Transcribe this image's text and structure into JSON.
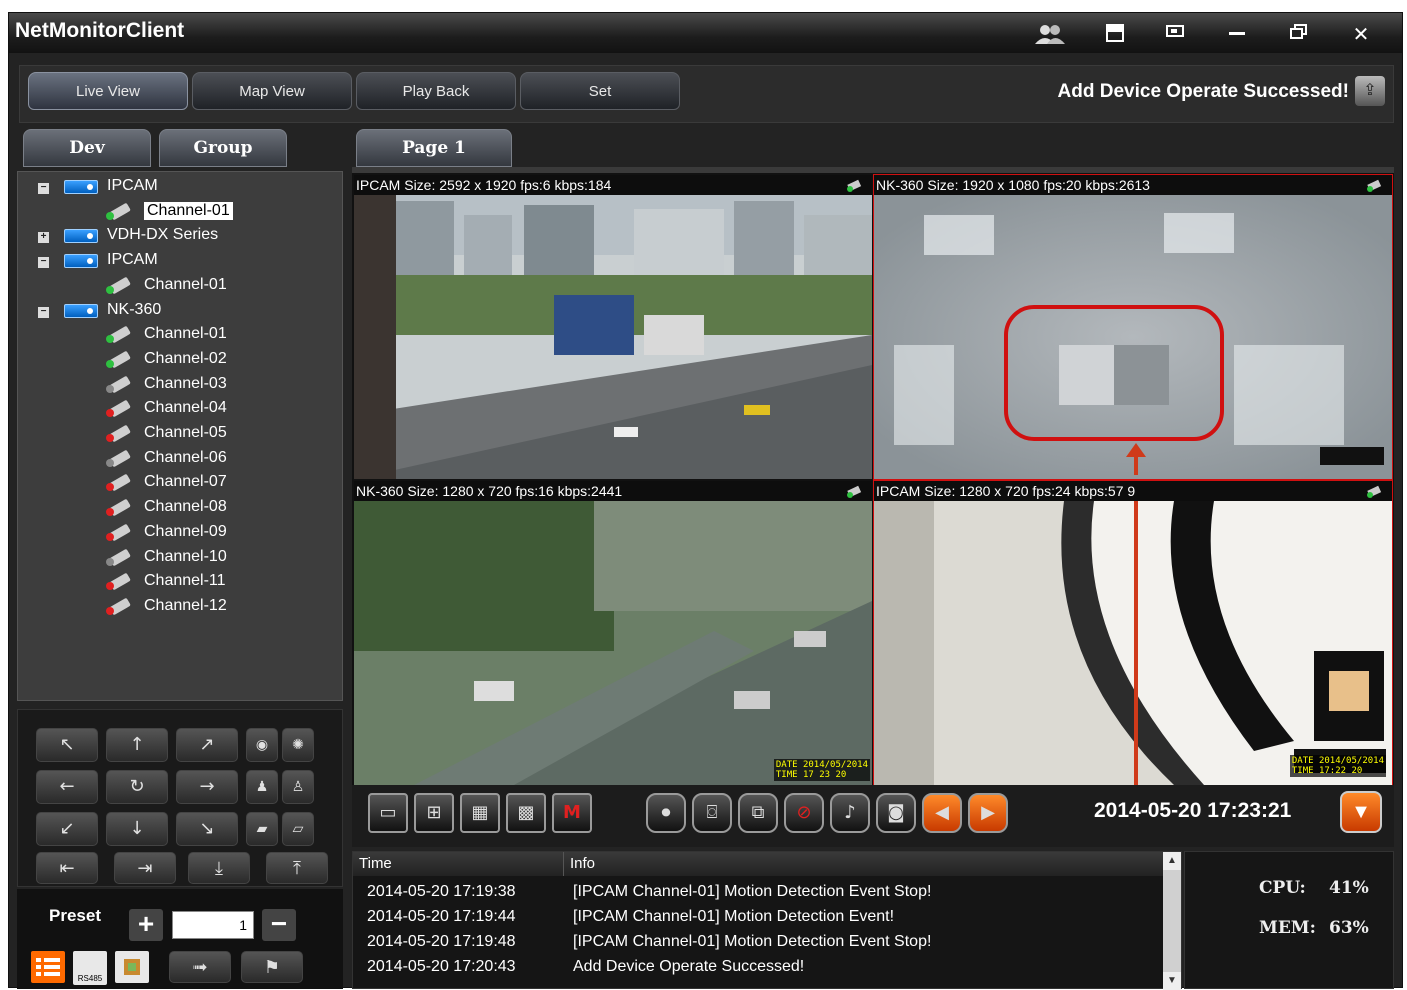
{
  "app": {
    "title": "NetMonitorClient"
  },
  "titlebar": {
    "buttons": [
      "users-icon",
      "layout-icon",
      "window-icon",
      "minimize-icon",
      "restore-icon",
      "close-icon"
    ]
  },
  "nav": {
    "tabs": [
      "Live View",
      "Map View",
      "Play Back",
      "Set"
    ],
    "status_message": "Add Device Operate Successed!"
  },
  "sidebar": {
    "tabs": [
      "Dev",
      "Group"
    ],
    "tree": [
      {
        "type": "device",
        "label": "IPCAM",
        "expanded": true
      },
      {
        "type": "channel",
        "label": "Channel-01",
        "status": "green",
        "selected": true
      },
      {
        "type": "device",
        "label": "VDH-DX Series",
        "expanded": false
      },
      {
        "type": "device",
        "label": "IPCAM",
        "expanded": true
      },
      {
        "type": "channel",
        "label": "Channel-01",
        "status": "green"
      },
      {
        "type": "device",
        "label": "NK-360",
        "expanded": true
      },
      {
        "type": "channel",
        "label": "Channel-01",
        "status": "green"
      },
      {
        "type": "channel",
        "label": "Channel-02",
        "status": "green"
      },
      {
        "type": "channel",
        "label": "Channel-03",
        "status": "gray"
      },
      {
        "type": "channel",
        "label": "Channel-04",
        "status": "red"
      },
      {
        "type": "channel",
        "label": "Channel-05",
        "status": "red"
      },
      {
        "type": "channel",
        "label": "Channel-06",
        "status": "gray"
      },
      {
        "type": "channel",
        "label": "Channel-07",
        "status": "red"
      },
      {
        "type": "channel",
        "label": "Channel-08",
        "status": "red"
      },
      {
        "type": "channel",
        "label": "Channel-09",
        "status": "red"
      },
      {
        "type": "channel",
        "label": "Channel-10",
        "status": "gray"
      },
      {
        "type": "channel",
        "label": "Channel-11",
        "status": "red"
      },
      {
        "type": "channel",
        "label": "Channel-12",
        "status": "red"
      }
    ]
  },
  "ptz": {
    "preset_label": "Preset",
    "preset_value": "1",
    "rs485_label": "RS485"
  },
  "page": {
    "tab_label": "Page 1"
  },
  "videos": [
    {
      "info": "IPCAM Size: 2592 x 1920 fps:6 kbps:184",
      "scene": "city"
    },
    {
      "info": "NK-360 Size: 1920 x 1080 fps:20 kbps:2613",
      "scene": "ceiling"
    },
    {
      "info": "NK-360 Size: 1280 x 720 fps:16 kbps:2441",
      "scene": "street",
      "osd": "DATE 2014/05/2014\nTIME 17 23 20"
    },
    {
      "info": "IPCAM Size: 1280 x 720 fps:24 kbps:57 9",
      "scene": "closeup",
      "osd": "DATE 2014/05/2014\nTIME 17:22 20"
    }
  ],
  "toolbar": {
    "datetime": "2014-05-20 17:23:21"
  },
  "log": {
    "columns": [
      "Time",
      "Info"
    ],
    "rows": [
      {
        "time": "2014-05-20 17:19:38",
        "info": "[IPCAM Channel-01] Motion Detection Event Stop!"
      },
      {
        "time": "2014-05-20 17:19:44",
        "info": "[IPCAM Channel-01] Motion Detection Event!"
      },
      {
        "time": "2014-05-20 17:19:48",
        "info": "[IPCAM Channel-01] Motion Detection Event Stop!"
      },
      {
        "time": "2014-05-20 17:20:43",
        "info": "Add Device Operate Successed!"
      }
    ]
  },
  "system": {
    "cpu_label": "CPU:",
    "cpu_value": "41%",
    "mem_label": "MEM:",
    "mem_value": "63%"
  },
  "colors": {
    "highlight": "#d01010",
    "accent_orange": "#ff6a00"
  }
}
